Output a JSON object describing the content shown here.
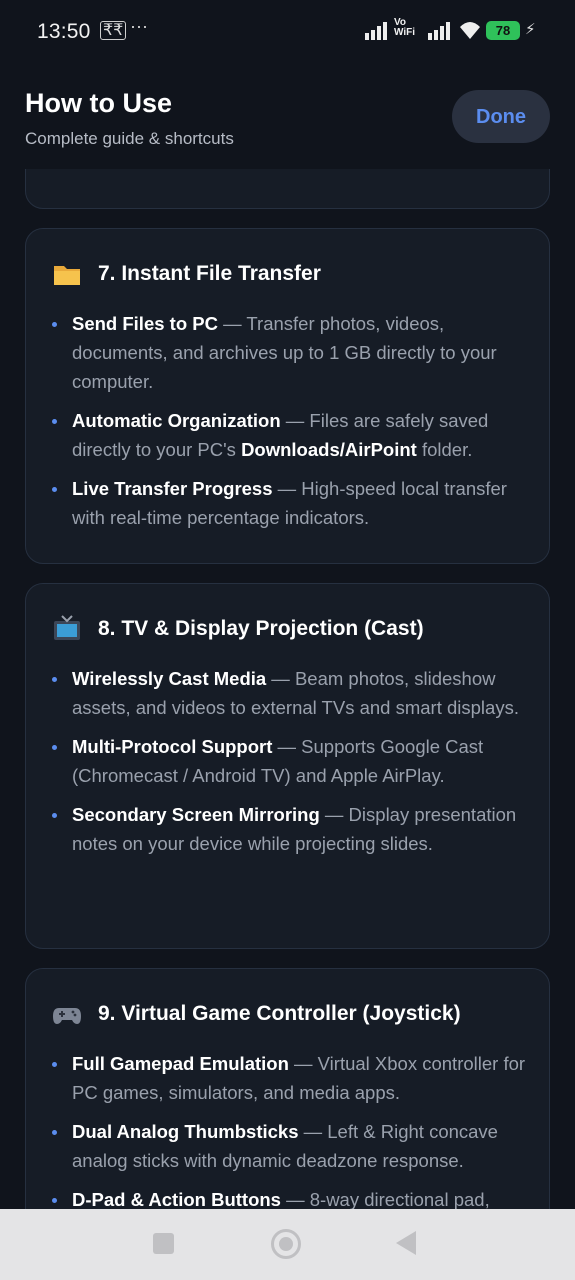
{
  "status_bar": {
    "time": "13:50",
    "currency_glyph": "₹₹",
    "dots": "···",
    "volte_line1": "Vo",
    "volte_line2": "WiFi",
    "battery": "78"
  },
  "header": {
    "title": "How to Use",
    "subtitle": "Complete guide & shortcuts",
    "done_label": "Done"
  },
  "sections": [
    {
      "icon": "folder-icon",
      "title": "7. Instant File Transfer",
      "bullets": [
        {
          "bold": "Send Files to PC",
          "text": " — Transfer photos, videos, documents, and archives up to 1 GB directly to your computer."
        },
        {
          "bold": "Automatic Organization",
          "text": " — Files are safely saved directly to your PC's ",
          "inline_bold": "Downloads/AirPoint",
          "text_after": " folder."
        },
        {
          "bold": "Live Transfer Progress",
          "text": " — High-speed local transfer with real-time percentage indicators."
        }
      ]
    },
    {
      "icon": "tv-icon",
      "title": "8. TV & Display Projection (Cast)",
      "bullets": [
        {
          "bold": "Wirelessly Cast Media",
          "text": " — Beam photos, slideshow assets, and videos to external TVs and smart displays."
        },
        {
          "bold": "Multi-Protocol Support",
          "text": " — Supports Google Cast (Chromecast / Android TV) and Apple AirPlay."
        },
        {
          "bold": "Secondary Screen Mirroring",
          "text": " — Display presentation notes on your device while projecting slides."
        }
      ]
    },
    {
      "icon": "gamepad-icon",
      "title": "9. Virtual Game Controller (Joystick)",
      "bullets": [
        {
          "bold": "Full Gamepad Emulation",
          "text": " — Virtual Xbox controller for PC games, simulators, and media apps."
        },
        {
          "bold": "Dual Analog Thumbsticks",
          "text": " — Left & Right concave analog sticks with dynamic deadzone response."
        },
        {
          "bold": "D-Pad & Action Buttons",
          "text": " — 8-way directional pad,"
        }
      ]
    }
  ],
  "nav_bar": {
    "recent_icon": "square-icon",
    "home_icon": "circle-icon",
    "back_icon": "triangle-back-icon"
  },
  "colors": {
    "background": "#10141c",
    "card": "#161c26",
    "accent": "#5b8def",
    "battery": "#2fc15a"
  }
}
